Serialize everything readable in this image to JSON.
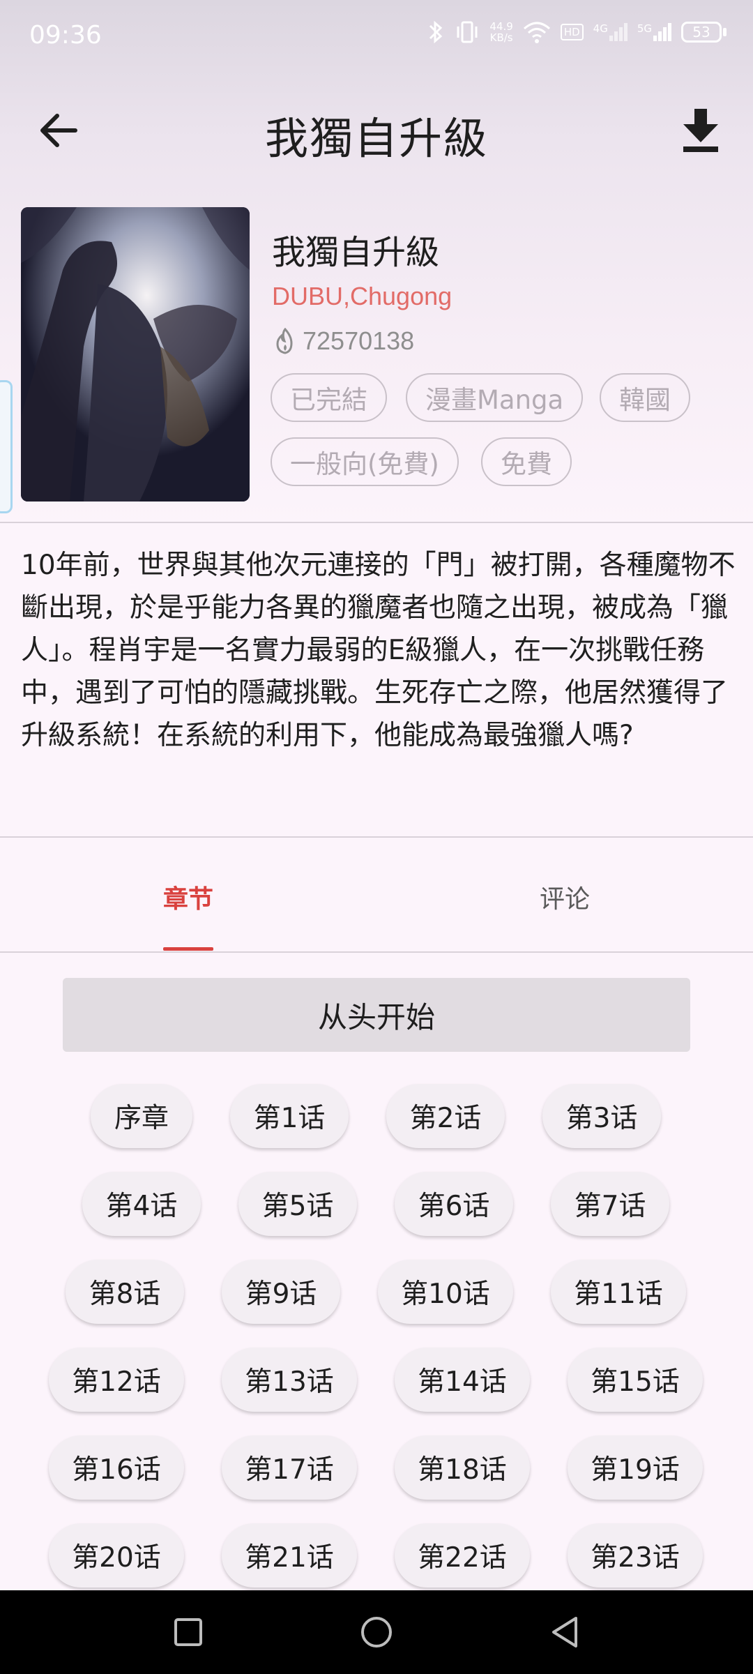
{
  "status_bar": {
    "time": "09:36",
    "speed_value": "44.9",
    "speed_unit": "KB/s",
    "hd_label": "HD",
    "network_4g": "4G",
    "network_5g": "5G",
    "battery": "53"
  },
  "header": {
    "title": "我獨自升級",
    "back_icon": "arrow-left-icon",
    "download_icon": "download-icon"
  },
  "manga": {
    "title": "我獨自升級",
    "author": "DUBU,Chugong",
    "views": "72570138",
    "tags": [
      "已完結",
      "漫畫Manga",
      "韓國",
      "一般向(免費)",
      "免費"
    ],
    "description": "10年前，世界與其他次元連接的「門」被打開，各種魔物不斷出現，於是乎能力各異的獵魔者也隨之出現，被成為「獵人」。程肖宇是一名實力最弱的E級獵人，在一次挑戰任務中，遇到了可怕的隱藏挑戰。生死存亡之際，他居然獲得了升級系統！在系統的利用下，他能成為最強獵人嗎?"
  },
  "tabs": {
    "chapters": "章节",
    "comments": "评论"
  },
  "start_button": "从头开始",
  "chapters": [
    "序章",
    "第1话",
    "第2话",
    "第3话",
    "第4话",
    "第5话",
    "第6话",
    "第7话",
    "第8话",
    "第9话",
    "第10话",
    "第11话",
    "第12话",
    "第13话",
    "第14话",
    "第15话",
    "第16话",
    "第17话",
    "第18话",
    "第19话",
    "第20话",
    "第21话",
    "第22话",
    "第23话"
  ],
  "colors": {
    "accent": "#d9413e",
    "author": "#e26b67",
    "background": "#fcf4fb"
  }
}
